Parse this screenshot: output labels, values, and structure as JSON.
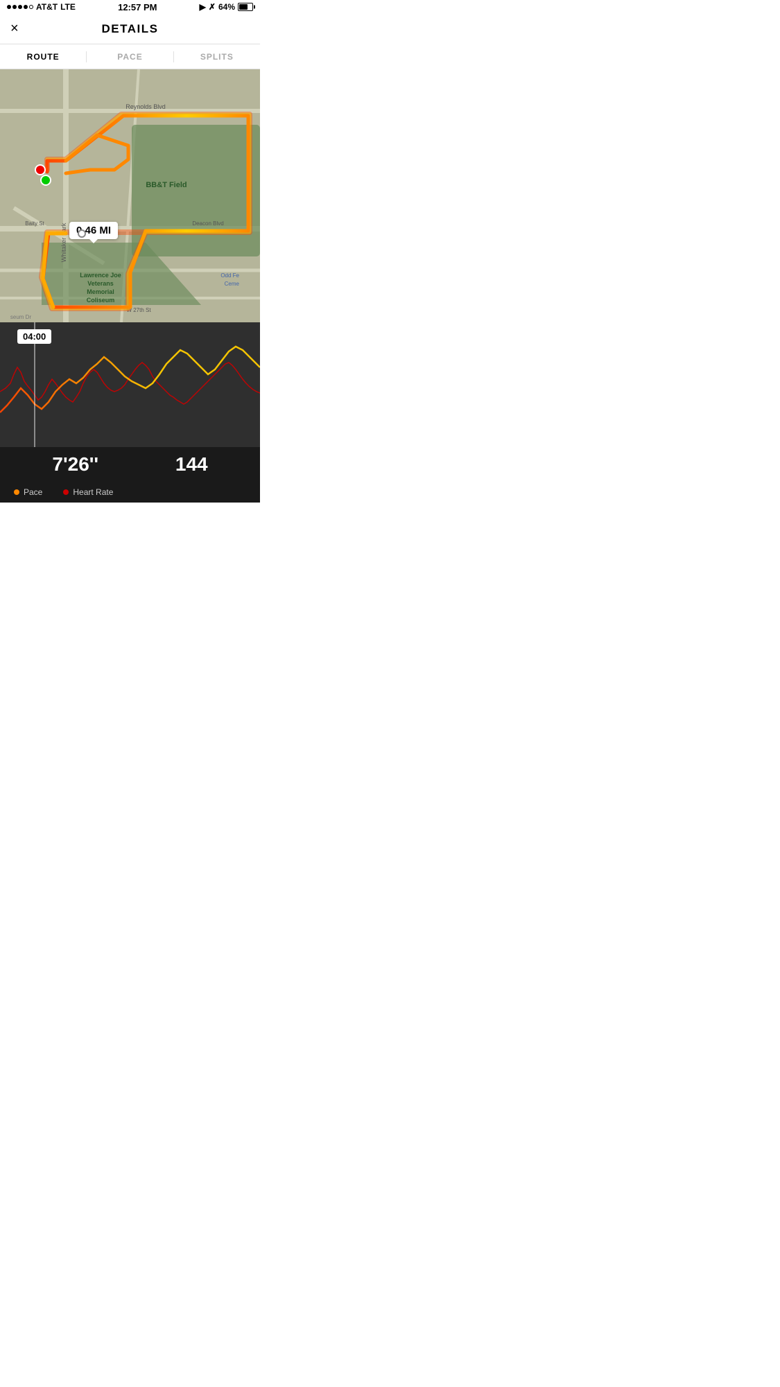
{
  "statusBar": {
    "carrier": "AT&T",
    "networkType": "LTE",
    "time": "12:57 PM",
    "batteryPercent": "64%"
  },
  "header": {
    "title": "DETAILS",
    "closeLabel": "×"
  },
  "tabs": [
    {
      "label": "ROUTE",
      "active": true
    },
    {
      "label": "PACE",
      "active": false
    },
    {
      "label": "SPLITS",
      "active": false
    }
  ],
  "map": {
    "distanceLabel": "0.46 MI",
    "timeTooltip": "04:00"
  },
  "stats": {
    "pace": "7'26''",
    "heartRate": "144"
  },
  "legend": {
    "paceLabel": "Pace",
    "heartRateLabel": "Heart Rate",
    "paceColor": "#ff8800",
    "heartRateColor": "#e00000"
  }
}
